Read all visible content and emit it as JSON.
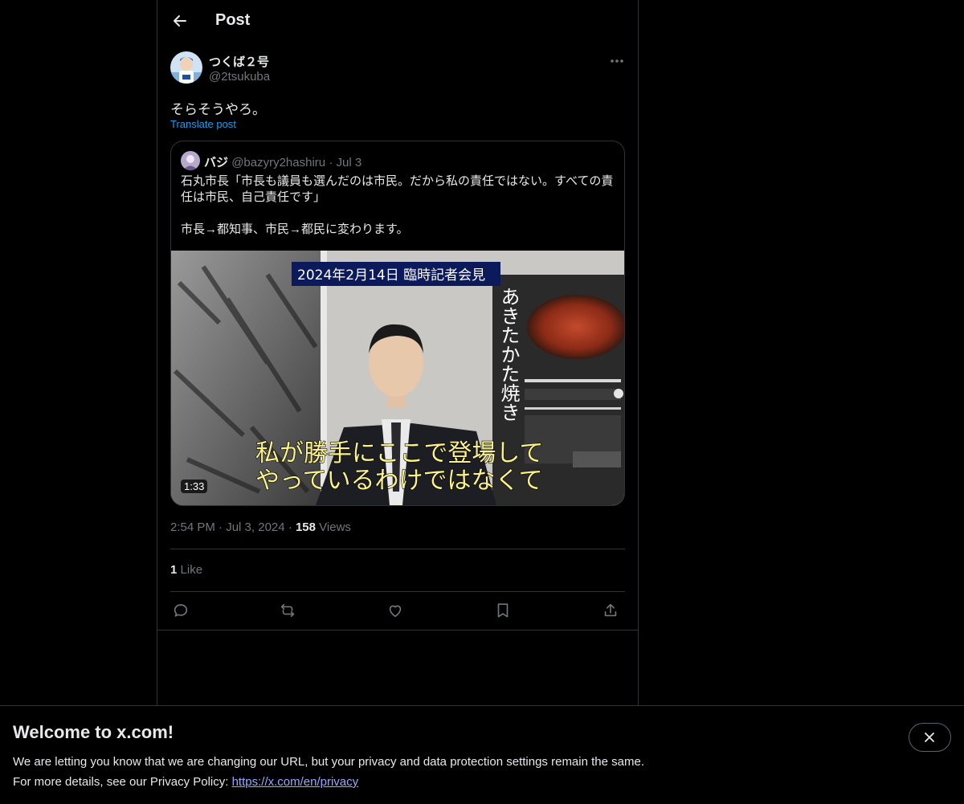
{
  "header": {
    "title": "Post",
    "back_icon": "arrow-left-icon"
  },
  "post": {
    "author_name": "つくば２号",
    "author_handle": "@2tsukuba",
    "text": "そらそうやろ。",
    "translate_label": "Translate post",
    "more_icon": "more-horizontal-icon",
    "time": "2:54 PM",
    "date": "Jul 3, 2024",
    "views_count": "158",
    "views_label": "Views",
    "separator": "·",
    "likes_count": "1",
    "likes_label": "Like"
  },
  "quote": {
    "author_name": "バジ",
    "author_handle": "@bazyry2hashiru",
    "separator": "·",
    "date": "Jul 3",
    "text": "石丸市長「市長も議員も選んだのは市民。だから私の責任ではない。すべての責任は市民、自己責任です」\n\n市長→都知事、市民→都民に変わります。",
    "video": {
      "duration": "1:33",
      "title_caption": "2024年2月14日 臨時記者会見",
      "subtitle_line1": "私が勝手にここで登場して",
      "subtitle_line2": "やっているわけではなくて",
      "poster_text": "あきたかた焼き"
    }
  },
  "actions": [
    {
      "name": "reply-icon"
    },
    {
      "name": "repost-icon"
    },
    {
      "name": "like-icon"
    },
    {
      "name": "bookmark-icon"
    },
    {
      "name": "share-icon"
    }
  ],
  "banner": {
    "title": "Welcome to x.com!",
    "line1": "We are letting you know that we are changing our URL, but your privacy and data protection settings remain the same.",
    "line2_prefix": "For more details, see our Privacy Policy: ",
    "link_text": "https://x.com/en/privacy",
    "close_icon": "close-icon"
  },
  "colors": {
    "background": "#000000",
    "text": "#e7e9ea",
    "secondary": "#71767b",
    "accent": "#1d9bf0",
    "border": "#2f3336",
    "link": "#9aa7ff"
  }
}
